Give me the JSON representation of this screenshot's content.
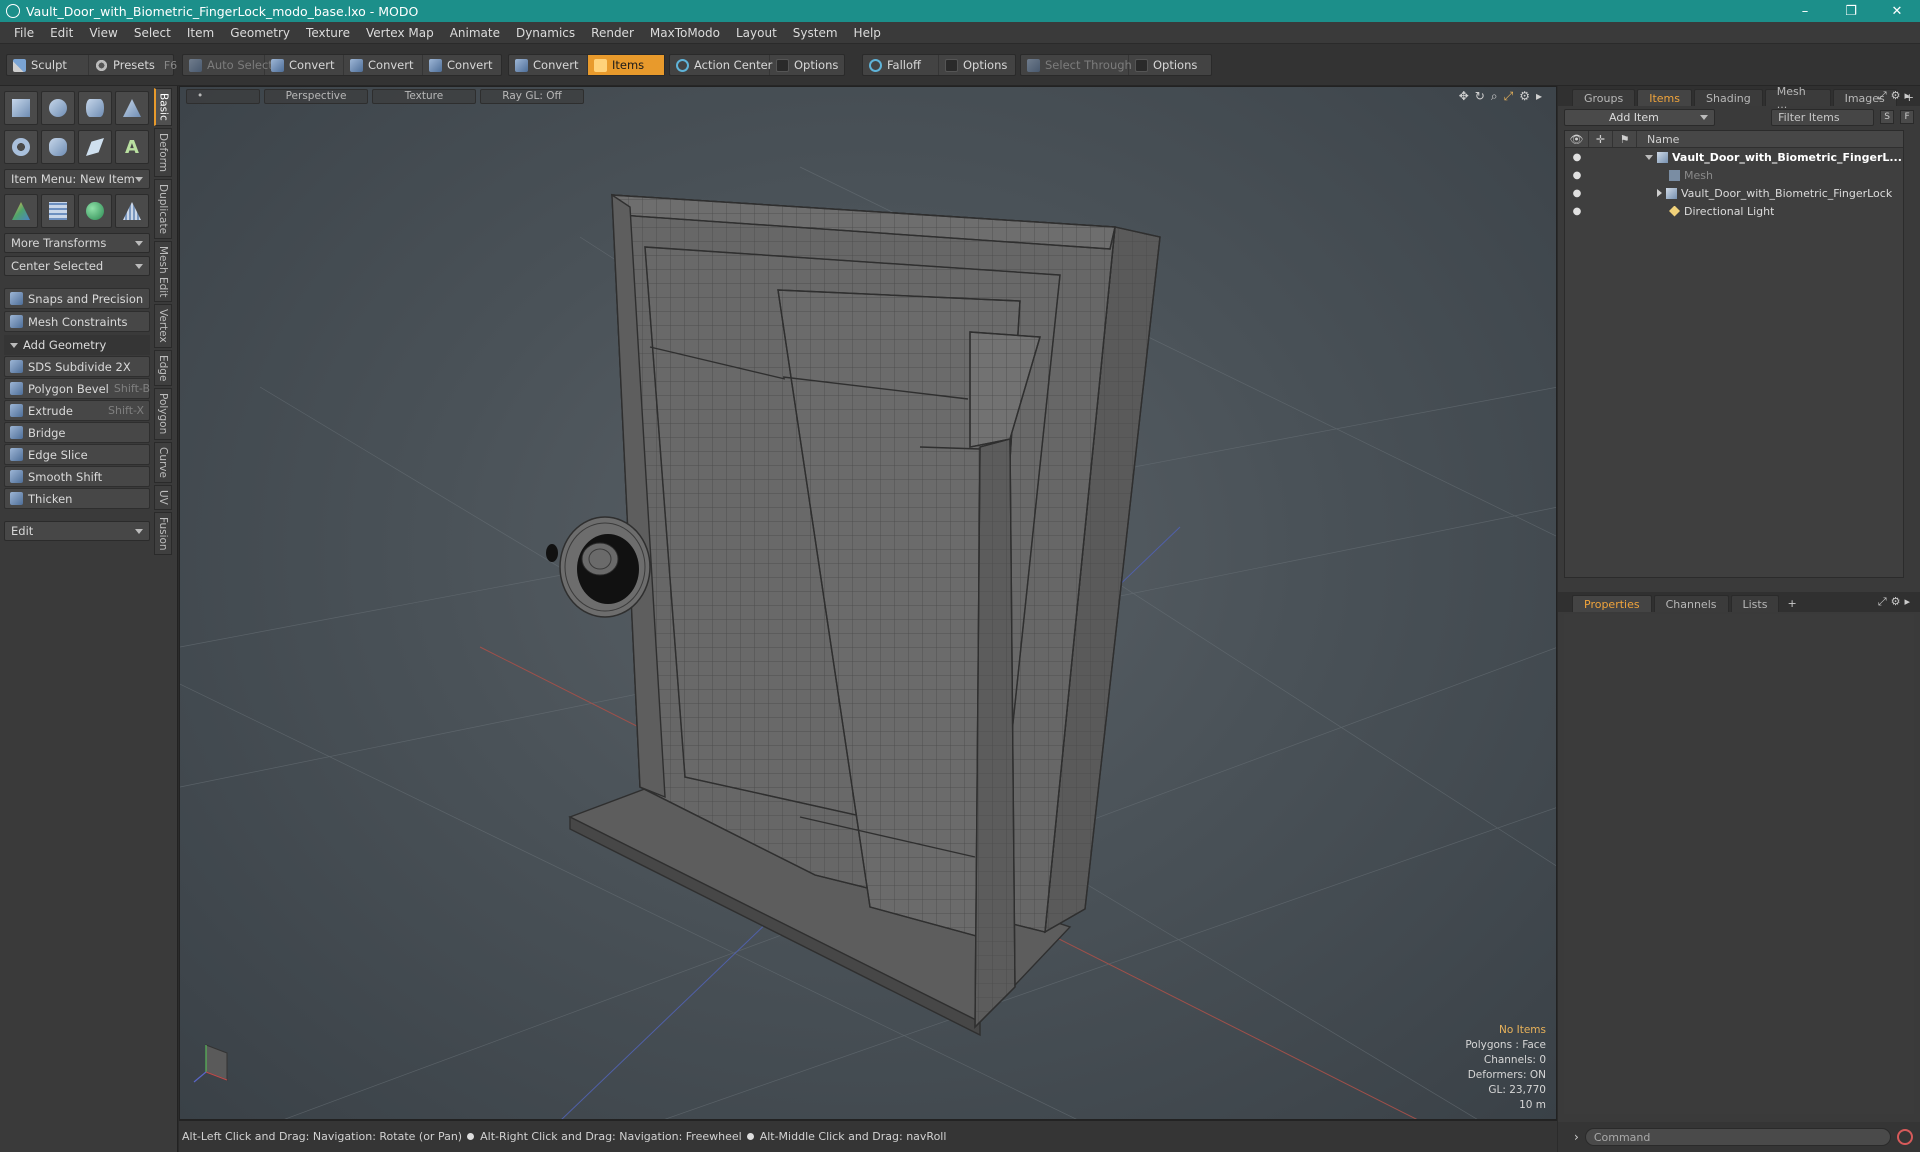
{
  "window": {
    "title": "Vault_Door_with_Biometric_FingerLock_modo_base.lxo - MODO",
    "controls": [
      "–",
      "❐",
      "✕"
    ]
  },
  "menu": [
    "File",
    "Edit",
    "View",
    "Select",
    "Item",
    "Geometry",
    "Texture",
    "Vertex Map",
    "Animate",
    "Dynamics",
    "Render",
    "MaxToModo",
    "Layout",
    "System",
    "Help"
  ],
  "toolbar": {
    "sculpt": "Sculpt",
    "presets": "Presets",
    "presets_key": "F6",
    "auto_select": "Auto Select",
    "convert1": "Convert",
    "convert2": "Convert",
    "convert3": "Convert",
    "convert4": "Convert",
    "items": "Items",
    "action_center": "Action Center",
    "options1": "Options",
    "falloff": "Falloff",
    "options2": "Options",
    "select_through": "Select Through",
    "options3": "Options"
  },
  "left": {
    "item_menu": "Item Menu: New Item",
    "more_transforms": "More Transforms",
    "center_selected": "Center Selected",
    "snaps": "Snaps and Precision",
    "mesh_constraints": "Mesh Constraints",
    "add_geometry": "Add Geometry",
    "tools": [
      {
        "label": "SDS Subdivide 2X",
        "key": ""
      },
      {
        "label": "Polygon Bevel",
        "key": "Shift-B"
      },
      {
        "label": "Extrude",
        "key": "Shift-X"
      },
      {
        "label": "Bridge",
        "key": ""
      },
      {
        "label": "Edge Slice",
        "key": ""
      },
      {
        "label": "Smooth Shift",
        "key": ""
      },
      {
        "label": "Thicken",
        "key": ""
      }
    ],
    "edit": "Edit",
    "vtabs": [
      "Basic",
      "Deform",
      "Duplicate",
      "Mesh Edit",
      "Vertex",
      "Edge",
      "Polygon",
      "Curve",
      "UV",
      "Fusion"
    ]
  },
  "viewport": {
    "perspective": "Perspective",
    "texture": "Texture",
    "raygl": "Ray GL: Off",
    "info": {
      "no_items": "No Items",
      "polygons": "Polygons : Face",
      "channels": "Channels: 0",
      "deformers": "Deformers: ON",
      "gl": "GL: 23,770",
      "scale": "10 m"
    }
  },
  "status": {
    "hint1": "Alt-Left Click and Drag: Navigation: Rotate (or Pan)",
    "hint2": "Alt-Right Click and Drag: Navigation: Freewheel",
    "hint3": "Alt-Middle Click and Drag: navRoll"
  },
  "right": {
    "tabs": [
      "Groups",
      "Items",
      "Shading",
      "Mesh ...",
      "Images"
    ],
    "add_item": "Add Item",
    "filter_placeholder": "Filter Items",
    "filter_s": "S",
    "filter_f": "F",
    "name_col": "Name",
    "tree": [
      {
        "label": "Vault_Door_with_Biometric_FingerL...",
        "style": "bold"
      },
      {
        "label": "Mesh",
        "style": "dim"
      },
      {
        "label": "Vault_Door_with_Biometric_FingerLock",
        "style": "normal"
      },
      {
        "label": "Directional Light",
        "style": "normal"
      }
    ],
    "props_tabs": [
      "Properties",
      "Channels",
      "Lists"
    ],
    "command_placeholder": "Command"
  },
  "colors": {
    "title_bar": "#1c8f8a",
    "accent": "#e89a2c"
  }
}
